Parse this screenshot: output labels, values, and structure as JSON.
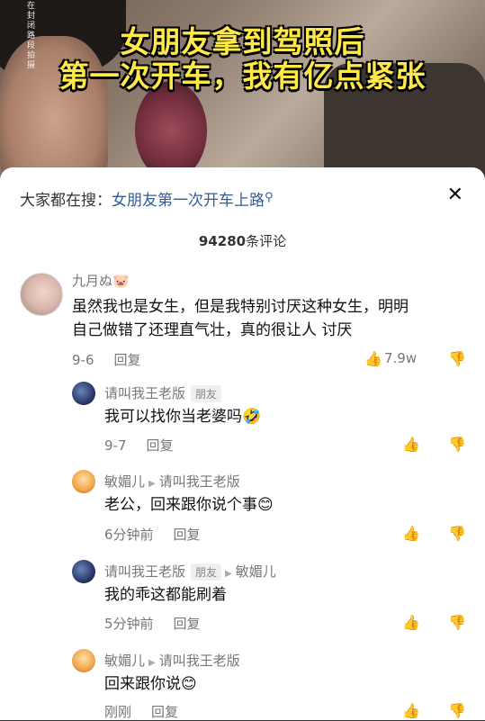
{
  "video": {
    "caption_line1": "女朋友拿到驾照后",
    "caption_line2": "第一次开车，我有亿点紧张",
    "side_text": "在封闭路段拍摄"
  },
  "search": {
    "prefix": "大家都在搜：",
    "query": "女朋友第一次开车上路",
    "close_glyph": "✕"
  },
  "comments_header": {
    "count": "94280",
    "suffix": "条评论"
  },
  "comments": {
    "main": {
      "author": "九月ぬ🐷",
      "text_line1": "虽然我也是女生，但是我特别讨厌这种女生，明明",
      "text_line2": "自己做错了还理直气壮，真的很让人 讨厌",
      "date": "9-6",
      "reply": "回复",
      "likes": "7.9w"
    },
    "replies": [
      {
        "author": "请叫我王老版",
        "tag": "朋友",
        "reply_to": "",
        "text": "我可以找你当老婆吗🤣",
        "time": "9-7",
        "reply": "回复"
      },
      {
        "author": "敏媚儿",
        "tag": "",
        "reply_to": "请叫我王老版",
        "text": "老公，回来跟你说个事😊",
        "time": "6分钟前",
        "reply": "回复"
      },
      {
        "author": "请叫我王老版",
        "tag": "朋友",
        "reply_to": "敏媚儿",
        "text": "我的乖这都能刷着",
        "time": "5分钟前",
        "reply": "回复"
      },
      {
        "author": "敏媚儿",
        "tag": "",
        "reply_to": "请叫我王老版",
        "text": "回来跟你说😊",
        "time": "刚刚",
        "reply": "回复"
      }
    ]
  },
  "icons": {
    "like": "thumb-up-icon",
    "dislike": "thumb-down-icon",
    "search": "search-icon",
    "close": "close-icon"
  }
}
